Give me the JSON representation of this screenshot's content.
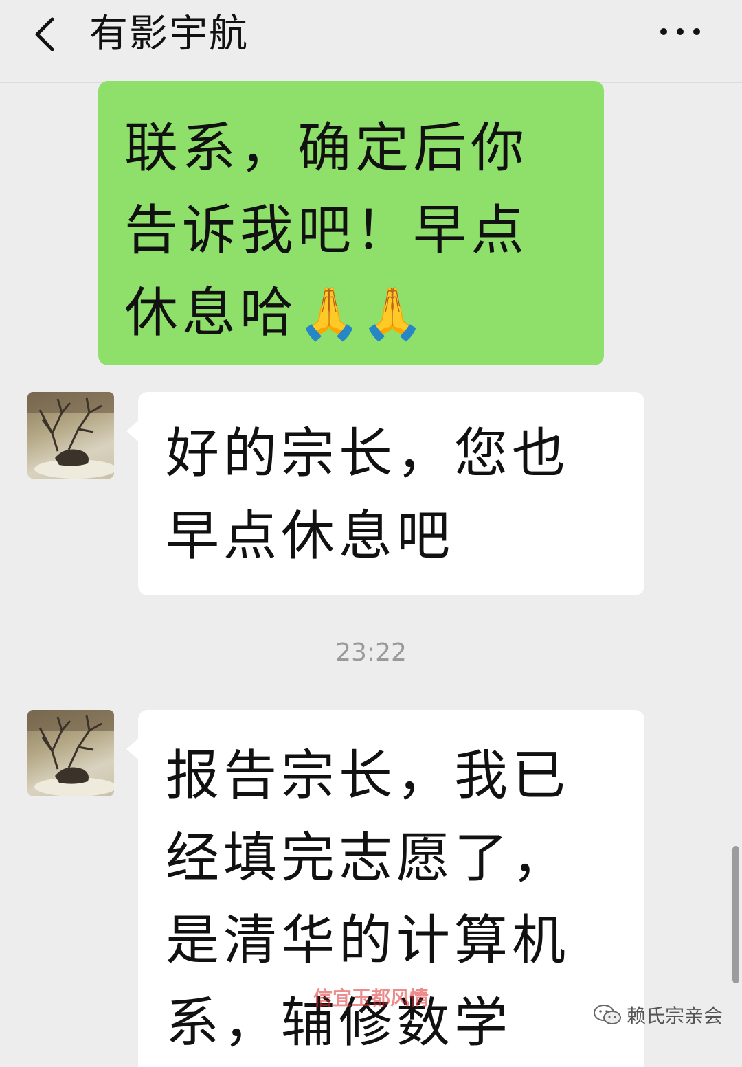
{
  "header": {
    "back_icon": "chevron-left-icon",
    "title": "有影宇航",
    "more_icon": "more-dots-icon"
  },
  "messages": [
    {
      "sender": "self",
      "lines": [
        "联系，确定后你",
        "告诉我吧！早点",
        "休息哈"
      ],
      "emoji": "🙏🙏",
      "bubble_color": "#8fe06a"
    },
    {
      "sender": "contact",
      "lines": [
        "好的宗长，您也",
        "早点休息吧"
      ],
      "bubble_color": "#ffffff"
    },
    {
      "sender": "contact",
      "lines": [
        "报告宗长，我已",
        "经填完志愿了，",
        "是清华的计算机",
        "系，辅修数学"
      ],
      "bubble_color": "#ffffff"
    }
  ],
  "timestamp": "23:22",
  "watermark": {
    "account_label": "赖氏宗亲会",
    "account_icon": "wechat-icon",
    "overlay_text": "信宜玉都风情"
  }
}
